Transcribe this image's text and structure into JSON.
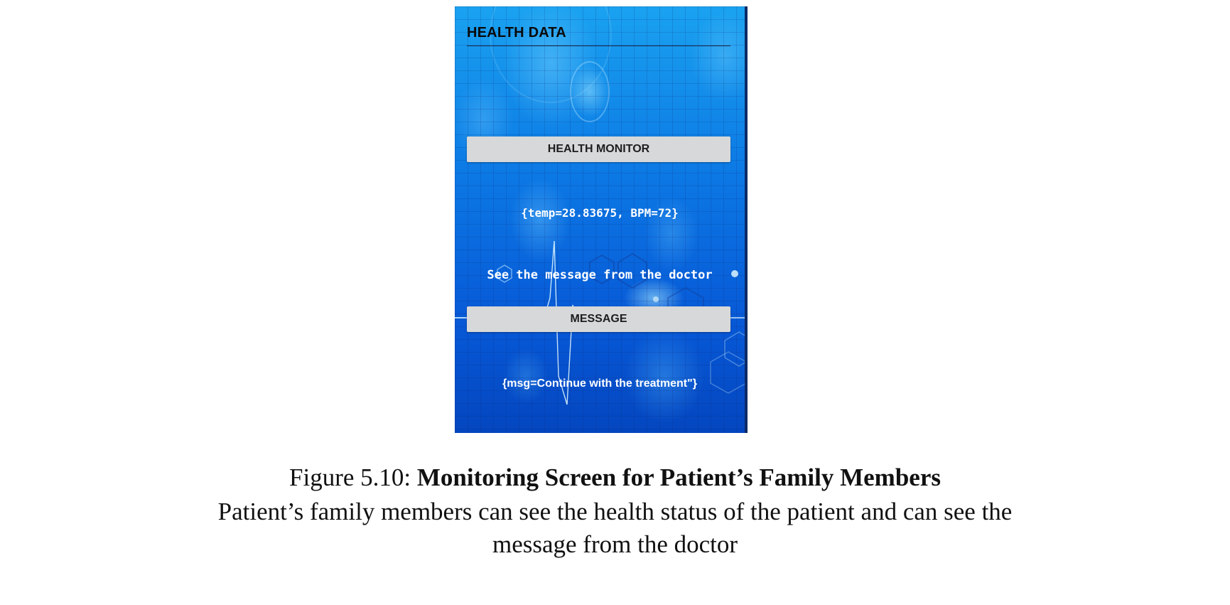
{
  "app": {
    "title": "HEALTH DATA",
    "health_monitor_button": "HEALTH MONITOR",
    "sensor_reading": "{temp=28.83675, BPM=72}",
    "doctor_prompt": "See the message from the doctor",
    "message_button": "MESSAGE",
    "doctor_message": "{msg=Continue with the treatment\"}"
  },
  "caption": {
    "figure_label": "Figure 5.10: ",
    "figure_title": "Monitoring Screen for Patient’s Family Members",
    "description_line1": "Patient’s family members can see the health status of the patient and can see the",
    "description_line2": "message from the doctor"
  },
  "colors": {
    "background_blue": "#0c78e4",
    "button_gray": "#d7d8d9",
    "title_text": "#0a0a0a",
    "value_text": "#ffffff"
  },
  "icons": {
    "background_art": "ecg-heartbeat-hexagon-background"
  }
}
